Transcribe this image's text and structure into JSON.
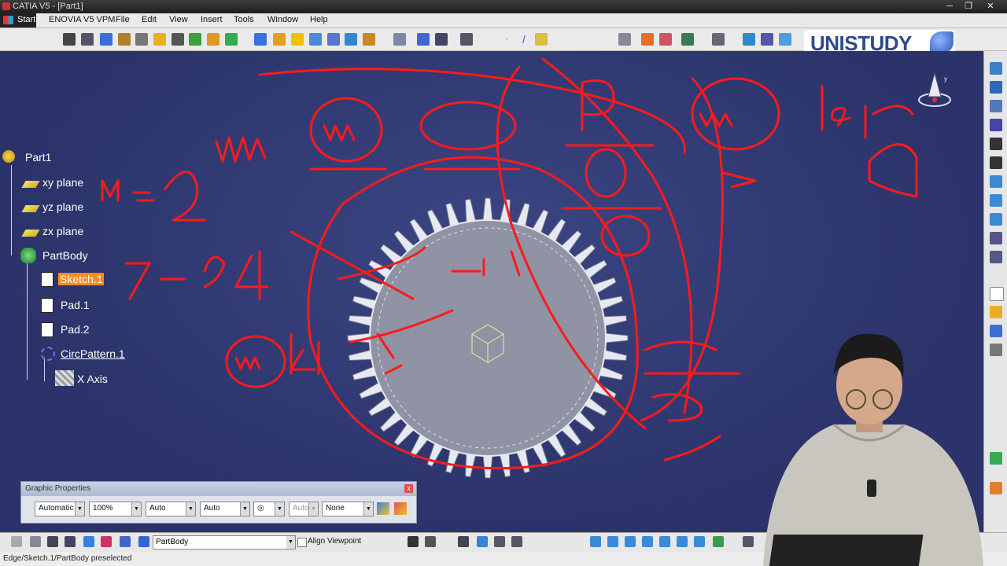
{
  "window": {
    "title": "CATIA V5 - [Part1]"
  },
  "menubar": {
    "start": "Start",
    "items": [
      "ENOVIA V5 VPM",
      "File",
      "Edit",
      "View",
      "Insert",
      "Tools",
      "Window",
      "Help"
    ]
  },
  "brand": {
    "text": "UNISTUDY"
  },
  "tree": {
    "root": "Part1",
    "xy": "xy plane",
    "yz": "yz plane",
    "zx": "zx plane",
    "body": "PartBody",
    "sketch": "Sketch.1",
    "pad1": "Pad.1",
    "pad2": "Pad.2",
    "pattern": "CircPattern.1",
    "axis": "X Axis"
  },
  "graphic_properties": {
    "title": "Graphic Properties",
    "close": "x",
    "color": "Automatic",
    "transparency": "100%",
    "linetype": "Auto",
    "thickness": "Auto",
    "point": "◎",
    "layer_auto": "Auto",
    "layer": "None"
  },
  "bottombar": {
    "current_body": "PartBody",
    "align_viewpoint": "Align Viewpoint"
  },
  "status": {
    "text": "Edge/Sketch.1/PartBody preselected"
  }
}
